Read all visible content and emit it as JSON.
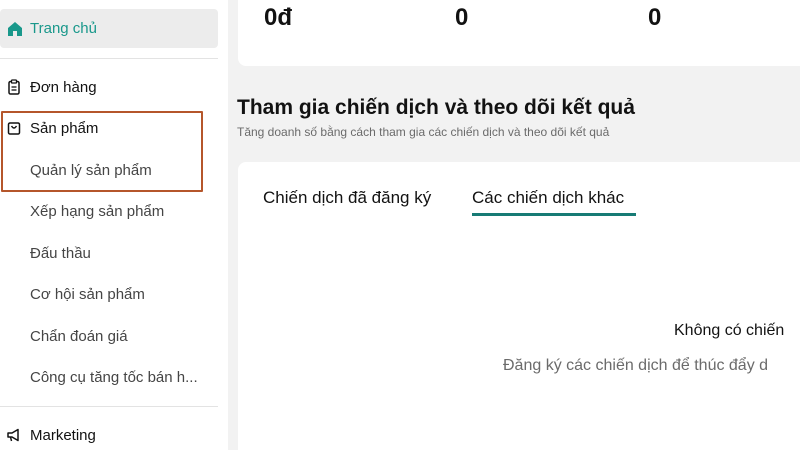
{
  "sidebar": {
    "home": {
      "label": "Trang chủ",
      "icon": "home-icon"
    },
    "orders": {
      "label": "Đơn hàng",
      "icon": "clipboard-icon"
    },
    "products": {
      "label": "Sản phẩm",
      "icon": "shopping-bag-icon",
      "items": [
        "Quản lý sản phẩm",
        "Xếp hạng sản phẩm",
        "Đấu thầu",
        "Cơ hội sản phẩm",
        "Chẩn đoán giá",
        "Công cụ tăng tốc bán h..."
      ]
    },
    "marketing": {
      "label": "Marketing",
      "icon": "megaphone-icon"
    }
  },
  "stats": [
    "0đ",
    "0",
    "0"
  ],
  "campaigns": {
    "title": "Tham gia chiến dịch và theo dõi kết quả",
    "subtitle": "Tăng doanh số bằng cách tham gia các chiến dịch và theo dõi kết quả",
    "tabs": [
      "Chiến dịch đã đăng ký",
      "Các chiến dịch khác"
    ],
    "active_tab": 1,
    "empty_title": "Không có chiến",
    "empty_desc": "Đăng ký các chiến dịch để thúc đẩy d"
  },
  "colors": {
    "accent": "#19988b",
    "tab_underline": "#177b75",
    "highlight_border": "#b5562b"
  }
}
